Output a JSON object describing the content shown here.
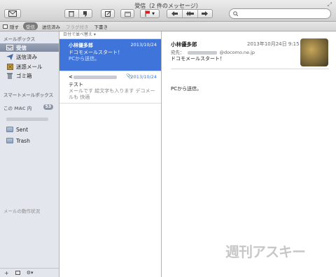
{
  "window": {
    "title": "受信（2 件のメッセージ）"
  },
  "toolbar": {
    "compose": "compose-icon",
    "delete": "trash-icon",
    "junk": "thumbs-down-icon",
    "new_note": "edit-icon",
    "archive": "archive-icon",
    "flag": "flag-icon",
    "reply": "reply-icon",
    "reply_all": "reply-all-icon",
    "forward": "forward-icon",
    "search": {
      "placeholder": "",
      "value": ""
    }
  },
  "favorites": {
    "hide_label": "隠す",
    "items": [
      "受信",
      "送信済み",
      "フラグ付き",
      "下書き"
    ]
  },
  "sidebar": {
    "mailboxes_header": "メールボックス",
    "mailboxes": [
      "受信",
      "送信済み",
      "迷惑メール",
      "ゴミ箱"
    ],
    "smart_header": "スマートメールボックス",
    "mac_header": "この MAC 内",
    "mac_badge": "53",
    "folders": [
      "Sent",
      "Trash"
    ],
    "activity_label": "メールの動作状況",
    "bottom": {
      "add": "+",
      "settings": "⚙▾"
    }
  },
  "message_list": {
    "sort_label": "日付で並べ替え ▾",
    "messages": [
      {
        "sender": "小林優多郎",
        "date": "2013/10/24",
        "subject": "ドコモメールスタート！",
        "preview": "PCから送信。"
      },
      {
        "sender": "<",
        "date": "2013/10/24",
        "subject": "テスト",
        "preview": "メールです 絵文字も入ります デコメールも 快適"
      }
    ]
  },
  "reader": {
    "from": "小林優多郎",
    "date": "2013年10月24日 9:15",
    "to_label": "宛先：",
    "to_domain": "@docomo.ne.jp",
    "subject": "ドコモメールスタート！",
    "body": "PCから送信。"
  },
  "watermark": "週刊アスキー",
  "colors": {
    "selection": "#3f74db",
    "sidebar": "#e3e6ec",
    "flag": "#d22020"
  }
}
